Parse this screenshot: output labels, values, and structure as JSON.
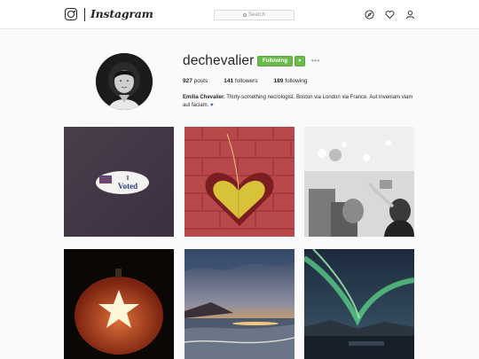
{
  "nav": {
    "wordmark": "Instagram",
    "search_placeholder": "Search",
    "icons": [
      "instagram-logo-icon",
      "compass-icon",
      "heart-icon",
      "user-icon"
    ]
  },
  "profile": {
    "username": "dechevalier",
    "follow_label": "Following",
    "more": "•••",
    "stats": {
      "posts_count": "927",
      "posts_label": "posts",
      "followers_count": "141",
      "followers_label": "followers",
      "following_count": "189",
      "following_label": "following"
    },
    "bio_name": "Emilia Chevalier.",
    "bio_text": " Thirty-something necrologist. Boston via London via France. Aut inveniam viam aut faciam. ",
    "bio_heart": "♥"
  },
  "posts": [
    {
      "subject": "I Voted sticker",
      "sticker_line1": "I",
      "sticker_line2": "Voted"
    },
    {
      "subject": "yellow heart-shaped leaf on red brick"
    },
    {
      "subject": "child reaching for bubbles, black and white"
    },
    {
      "subject": "carved pumpkin with star"
    },
    {
      "subject": "sunset over beach"
    },
    {
      "subject": "northern lights over lake"
    }
  ],
  "colors": {
    "follow_green": "#6cbb4a",
    "accent_blue": "#3b5ea8"
  }
}
